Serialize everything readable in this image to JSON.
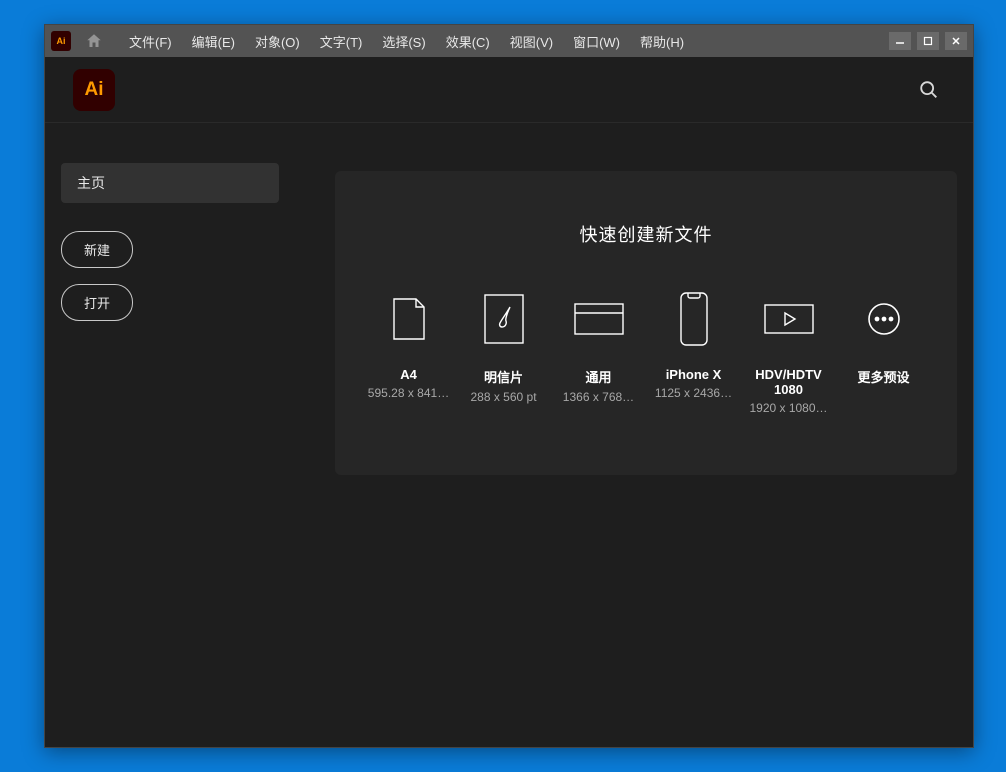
{
  "app": {
    "short_name": "Ai"
  },
  "menu": {
    "file": "文件(F)",
    "edit": "编辑(E)",
    "object": "对象(O)",
    "type": "文字(T)",
    "select": "选择(S)",
    "effect": "效果(C)",
    "view": "视图(V)",
    "window": "窗口(W)",
    "help": "帮助(H)"
  },
  "sidebar": {
    "home_tab": "主页",
    "new_btn": "新建",
    "open_btn": "打开"
  },
  "main": {
    "title": "快速创建新文件",
    "presets": [
      {
        "label": "A4",
        "dims": "595.28 x 841…"
      },
      {
        "label": "明信片",
        "dims": "288 x 560 pt"
      },
      {
        "label": "通用",
        "dims": "1366 x 768…"
      },
      {
        "label": "iPhone X",
        "dims": "1125 x 2436…"
      },
      {
        "label": "HDV/HDTV 1080",
        "dims": "1920 x 1080…"
      },
      {
        "label": "更多预设",
        "dims": ""
      }
    ]
  }
}
